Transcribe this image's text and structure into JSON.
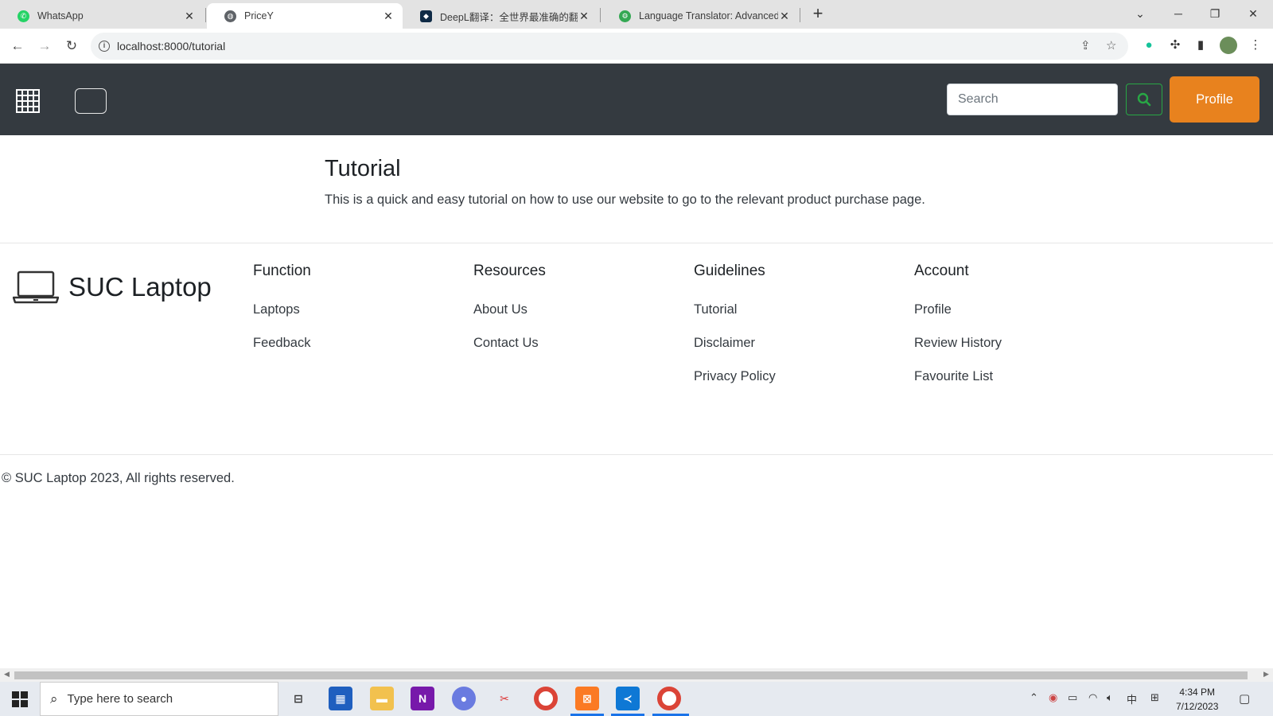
{
  "browser": {
    "tabs": [
      {
        "title": "WhatsApp",
        "icon": "whatsapp-icon",
        "color": "#25d366"
      },
      {
        "title": "PriceY",
        "icon": "globe-icon",
        "color": "#5f6368"
      },
      {
        "title": "DeepL翻译：全世界最准确的翻译",
        "icon": "deepl-icon",
        "color": "#0f2b46"
      },
      {
        "title": "Language Translator: Advanced",
        "icon": "translator-icon",
        "color": "#34a853"
      }
    ],
    "url": "localhost:8000/tutorial"
  },
  "navbar": {
    "search_placeholder": "Search",
    "profile_label": "Profile",
    "accent_color": "#e8821e",
    "background_color": "#343a40"
  },
  "main": {
    "title": "Tutorial",
    "description": "This is a quick and easy tutorial on how to use our website to go to the relevant product purchase page."
  },
  "footer": {
    "brand": "SUC Laptop",
    "columns": [
      {
        "heading": "Function",
        "links": [
          "Laptops",
          "Feedback"
        ]
      },
      {
        "heading": "Resources",
        "links": [
          "About Us",
          "Contact Us"
        ]
      },
      {
        "heading": "Guidelines",
        "links": [
          "Tutorial",
          "Disclaimer",
          "Privacy Policy"
        ]
      },
      {
        "heading": "Account",
        "links": [
          "Profile",
          "Review History",
          "Favourite List"
        ]
      }
    ],
    "copyright": "© SUC Laptop 2023, All rights reserved."
  },
  "taskbar": {
    "search_placeholder": "Type here to search",
    "time": "4:34 PM",
    "date": "7/12/2023",
    "ime": "中"
  }
}
